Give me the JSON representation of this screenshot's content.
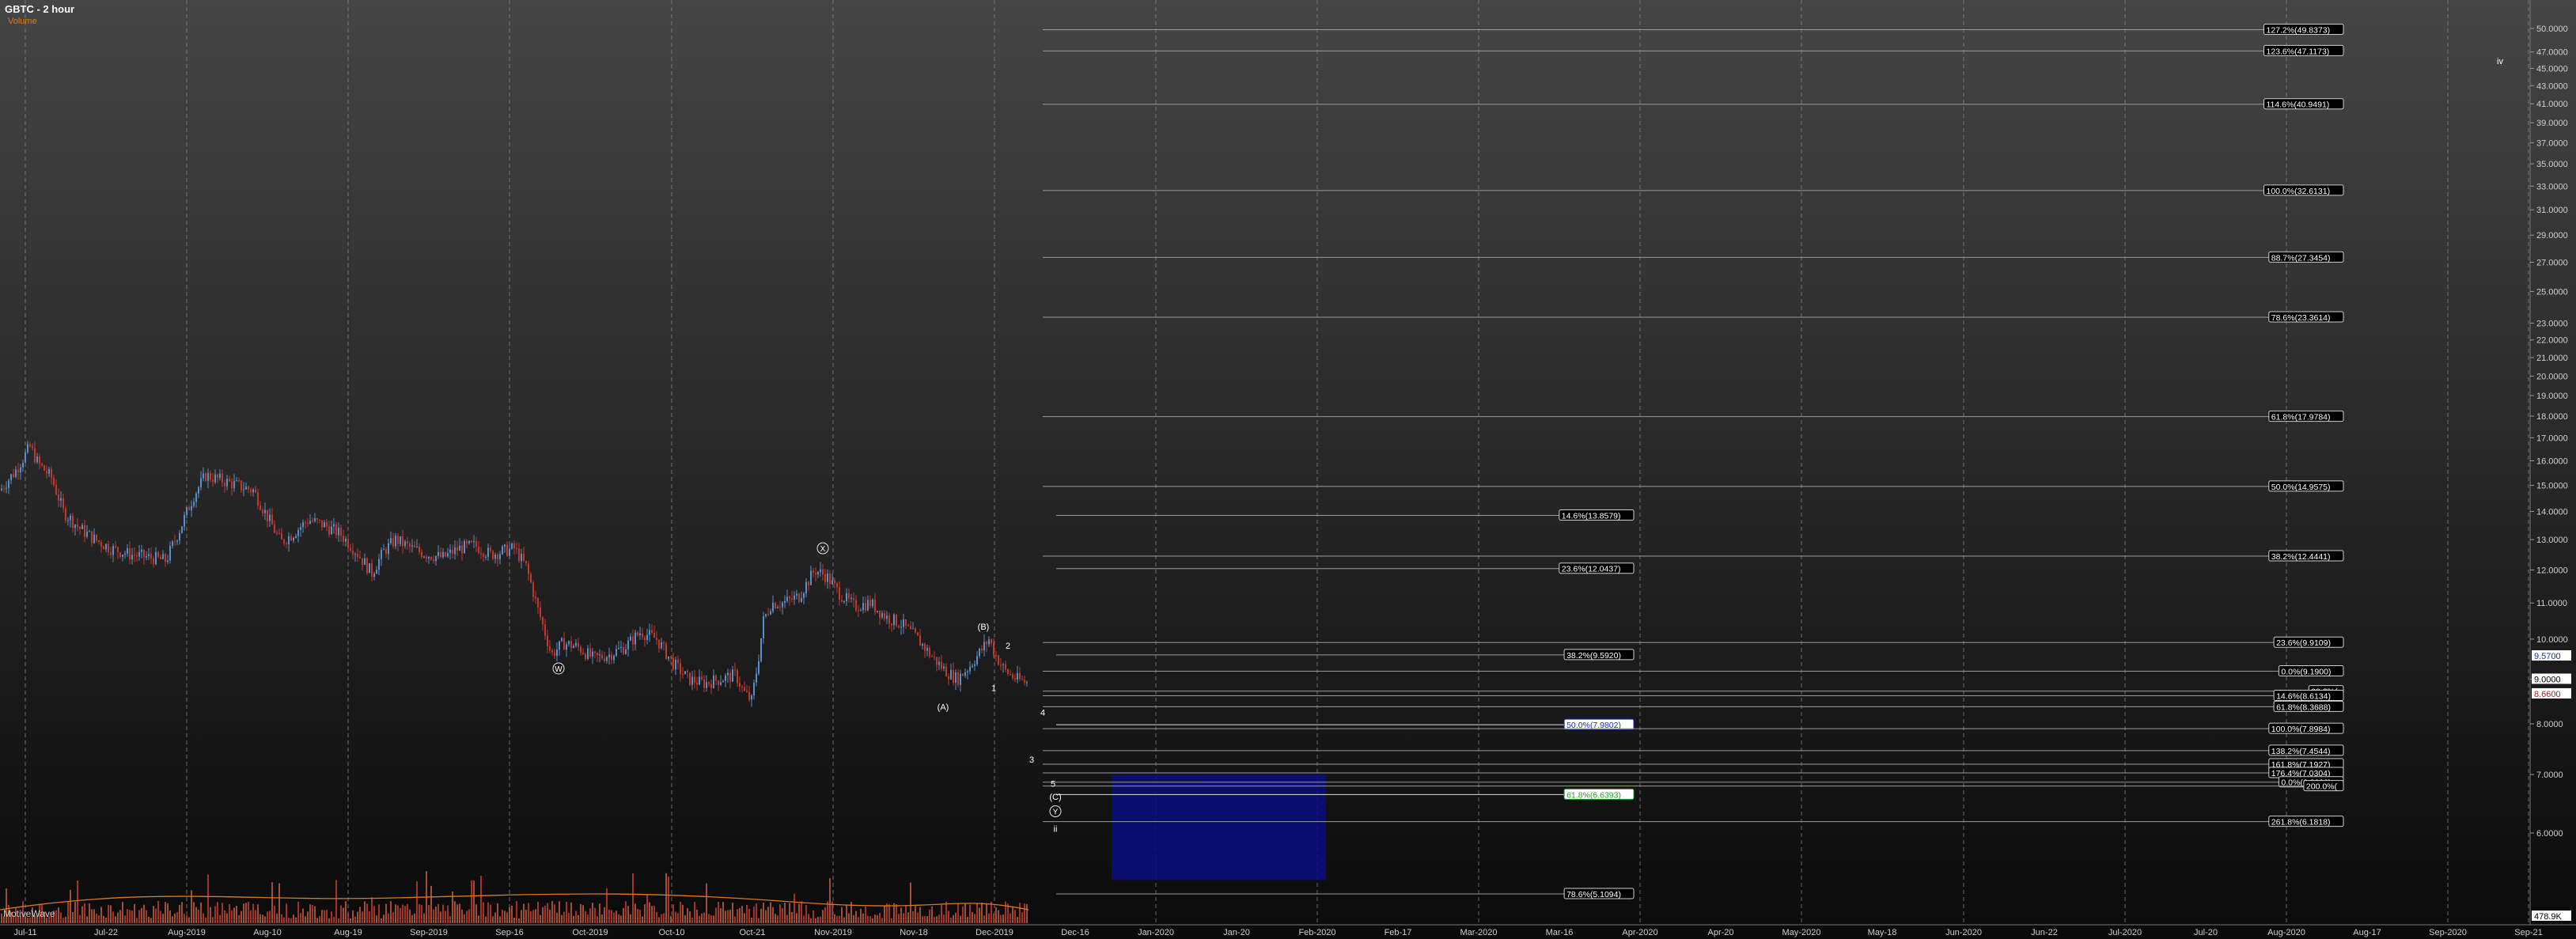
{
  "header": {
    "title": "GBTC - 2 hour",
    "indicator": "Volume"
  },
  "watermark": "MotiveWave",
  "colors": {
    "up": "#5b8dc9",
    "down": "#c0392b",
    "zone": "#0a0d78",
    "fib_line": "#9a9a9a",
    "label_bg": "#000000"
  },
  "chart_data": {
    "type": "candlestick",
    "title": "GBTC - 2 hour",
    "y_scale": "log",
    "ylim": [
      4.8,
      53
    ],
    "y_ticks": [
      6.0,
      7.0,
      8.0,
      9.0,
      10.0,
      11.0,
      12.0,
      13.0,
      14.0,
      15.0,
      16.0,
      17.0,
      18.0,
      19.0,
      20.0,
      21.0,
      22.0,
      23.0,
      25.0,
      27.0,
      29.0,
      31.0,
      33.0,
      35.0,
      37.0,
      39.0,
      41.0,
      43.0,
      45.0,
      47.0,
      50.0
    ],
    "y_tick_labels": [
      "6.0000",
      "7.0000",
      "8.0000",
      "9.0000",
      "10.0000",
      "11.0000",
      "12.0000",
      "13.0000",
      "14.0000",
      "15.0000",
      "16.0000",
      "17.0000",
      "18.0000",
      "19.0000",
      "20.0000",
      "21.0000",
      "22.0000",
      "23.0000",
      "25.0000",
      "27.0000",
      "29.0000",
      "31.0000",
      "33.0000",
      "35.0000",
      "37.0000",
      "39.0000",
      "41.0000",
      "43.0000",
      "45.0000",
      "47.0000",
      "50.0000"
    ],
    "price_markers": [
      {
        "label": "9.5700",
        "value": 9.57,
        "style": "blue"
      },
      {
        "label": "9.0000",
        "value": 9.0,
        "style": "white"
      },
      {
        "label": "8.6600",
        "value": 8.66,
        "style": "red"
      }
    ],
    "volume_marker": "478.9K",
    "x_ticks": [
      "Jul-11",
      "Jul-22",
      "Aug-2019",
      "Aug-10",
      "Aug-19",
      "Sep-2019",
      "Sep-16",
      "Oct-2019",
      "Oct-10",
      "Oct-21",
      "Nov-2019",
      "Nov-18",
      "Dec-2019",
      "Dec-16",
      "Jan-2020",
      "Jan-20",
      "Feb-2020",
      "Feb-17",
      "Mar-2020",
      "Mar-16",
      "Apr-2020",
      "Apr-20",
      "May-2020",
      "May-18",
      "Jun-2020",
      "Jun-22",
      "Jul-2020",
      "Jul-20",
      "Aug-2020",
      "Aug-17",
      "Sep-2020",
      "Sep-21"
    ],
    "price_path": [
      [
        0,
        14.8
      ],
      [
        20,
        15.6
      ],
      [
        38,
        16.6
      ],
      [
        48,
        15.9
      ],
      [
        65,
        15.3
      ],
      [
        80,
        14.0
      ],
      [
        100,
        13.4
      ],
      [
        120,
        13.0
      ],
      [
        140,
        12.7
      ],
      [
        165,
        12.5
      ],
      [
        190,
        12.4
      ],
      [
        210,
        12.3
      ],
      [
        228,
        13.4
      ],
      [
        245,
        14.6
      ],
      [
        260,
        15.4
      ],
      [
        280,
        15.2
      ],
      [
        300,
        15.0
      ],
      [
        320,
        14.8
      ],
      [
        340,
        13.7
      ],
      [
        355,
        12.9
      ],
      [
        370,
        13.2
      ],
      [
        390,
        13.7
      ],
      [
        410,
        13.5
      ],
      [
        430,
        13.2
      ],
      [
        450,
        12.6
      ],
      [
        470,
        11.9
      ],
      [
        485,
        12.6
      ],
      [
        500,
        13.0
      ],
      [
        520,
        12.7
      ],
      [
        540,
        12.5
      ],
      [
        560,
        12.4
      ],
      [
        580,
        12.7
      ],
      [
        600,
        12.8
      ],
      [
        620,
        12.5
      ],
      [
        650,
        12.7
      ],
      [
        665,
        12.1
      ],
      [
        680,
        10.8
      ],
      [
        697,
        9.6
      ],
      [
        712,
        9.9
      ],
      [
        730,
        9.8
      ],
      [
        750,
        9.5
      ],
      [
        770,
        9.6
      ],
      [
        790,
        9.8
      ],
      [
        810,
        10.2
      ],
      [
        830,
        10.0
      ],
      [
        850,
        9.4
      ],
      [
        870,
        9.0
      ],
      [
        890,
        8.9
      ],
      [
        910,
        9.0
      ],
      [
        930,
        9.1
      ],
      [
        940,
        8.7
      ],
      [
        950,
        8.5
      ],
      [
        958,
        9.4
      ],
      [
        965,
        10.5
      ],
      [
        975,
        11.0
      ],
      [
        990,
        11.0
      ],
      [
        1010,
        11.2
      ],
      [
        1030,
        12.0
      ],
      [
        1045,
        11.8
      ],
      [
        1060,
        11.3
      ],
      [
        1080,
        10.9
      ],
      [
        1100,
        11.0
      ],
      [
        1120,
        10.6
      ],
      [
        1140,
        10.4
      ],
      [
        1160,
        10.0
      ],
      [
        1180,
        9.5
      ],
      [
        1195,
        9.2
      ],
      [
        1210,
        9.0
      ],
      [
        1225,
        9.3
      ],
      [
        1240,
        9.7
      ],
      [
        1250,
        10.0
      ],
      [
        1258,
        9.6
      ],
      [
        1270,
        9.2
      ],
      [
        1285,
        9.0
      ],
      [
        1300,
        8.9
      ]
    ],
    "fib_levels": [
      {
        "label": "127.2%(49.8373)",
        "value": 49.8373,
        "x0": 1318
      },
      {
        "label": "123.6%(47.1173)",
        "value": 47.1173,
        "x0": 1318
      },
      {
        "label": "114.6%(40.9491)",
        "value": 40.9491,
        "x0": 1318
      },
      {
        "label": "100.0%(32.6131)",
        "value": 32.6131,
        "x0": 1318
      },
      {
        "label": "88.7%(27.3454)",
        "value": 27.3454,
        "x0": 1318
      },
      {
        "label": "78.6%(23.3614)",
        "value": 23.3614,
        "x0": 1318
      },
      {
        "label": "61.8%(17.9784)",
        "value": 17.9784,
        "x0": 1318
      },
      {
        "label": "50.0%(14.9575)",
        "value": 14.9575,
        "x0": 1318
      },
      {
        "label": "38.2%(12.4441)",
        "value": 12.4441,
        "x0": 1318
      },
      {
        "label": "23.6%(9.9109)",
        "value": 9.9109,
        "x0": 1318
      },
      {
        "label": "14.6%(13.8579)",
        "value": 13.8579,
        "x0": 1335,
        "x1": 2065
      },
      {
        "label": "23.6%(12.0437)",
        "value": 12.0437,
        "x0": 1335,
        "x1": 2065
      },
      {
        "label": "38.2%(9.5920)",
        "value": 9.592,
        "x0": 1335,
        "x1": 2065
      },
      {
        "label": "0.0%(9.1900)",
        "value": 9.19,
        "x0": 1318
      },
      {
        "label": "38.2%(",
        "value": 8.72,
        "x0": 1318,
        "x1": 2962
      },
      {
        "label": "14.6%(8.6134)",
        "value": 8.6134,
        "x0": 1318
      },
      {
        "label": "61.8%(8.3688)",
        "value": 8.3688,
        "x0": 1318
      },
      {
        "label": "50.0%(7.9802)",
        "value": 7.9802,
        "x0": 1335,
        "x1": 2065,
        "highlight": "blue"
      },
      {
        "label": "100.0%(7.8984)",
        "value": 7.8984,
        "x0": 1318
      },
      {
        "label": "138.2%(7.4544)",
        "value": 7.4544,
        "x0": 1318
      },
      {
        "label": "161.8%(7.1927)",
        "value": 7.1927,
        "x0": 1318
      },
      {
        "label": "176.4%(7.0304)",
        "value": 7.0304,
        "x0": 1318
      },
      {
        "label": "0.0%(6.8600)",
        "value": 6.86,
        "x0": 1318
      },
      {
        "label": "200.0%(",
        "value": 6.79,
        "x0": 1318,
        "x1": 2962
      },
      {
        "label": "61.8%(6.6393)",
        "value": 6.6393,
        "x0": 1335,
        "x1": 2065,
        "highlight": "green"
      },
      {
        "label": "261.8%(6.1818)",
        "value": 6.1818,
        "x0": 1318
      },
      {
        "label": "78.6%(5.1094)",
        "value": 5.1094,
        "x0": 1335,
        "x1": 2065
      }
    ],
    "wave_labels": [
      {
        "text": "W",
        "circle": true,
        "x": 706,
        "value": 9.18
      },
      {
        "text": "X",
        "circle": true,
        "x": 1040,
        "value": 12.6
      },
      {
        "text": "(B)",
        "circle": false,
        "x": 1243,
        "value": 10.25
      },
      {
        "text": "(A)",
        "circle": false,
        "x": 1192,
        "value": 8.3
      },
      {
        "text": "2",
        "circle": false,
        "x": 1274,
        "value": 9.75
      },
      {
        "text": "1",
        "circle": false,
        "x": 1256,
        "value": 8.72
      },
      {
        "text": "4",
        "circle": false,
        "x": 1318,
        "value": 8.18
      },
      {
        "text": "3",
        "circle": false,
        "x": 1304,
        "value": 7.22
      },
      {
        "text": "5",
        "circle": false,
        "x": 1331,
        "value": 6.78
      },
      {
        "text": "(C)",
        "circle": false,
        "x": 1334,
        "value": 6.55
      },
      {
        "text": "Y",
        "circle": true,
        "x": 1334,
        "value": 6.3
      },
      {
        "text": "ii",
        "circle": false,
        "x": 1334,
        "value": 6.02
      },
      {
        "text": "iv",
        "circle": false,
        "x": 3160,
        "value": 45.5
      }
    ],
    "target_zone": {
      "x0": 1405,
      "x1": 1676,
      "value_top": 7.0,
      "value_bottom": 5.3
    }
  }
}
